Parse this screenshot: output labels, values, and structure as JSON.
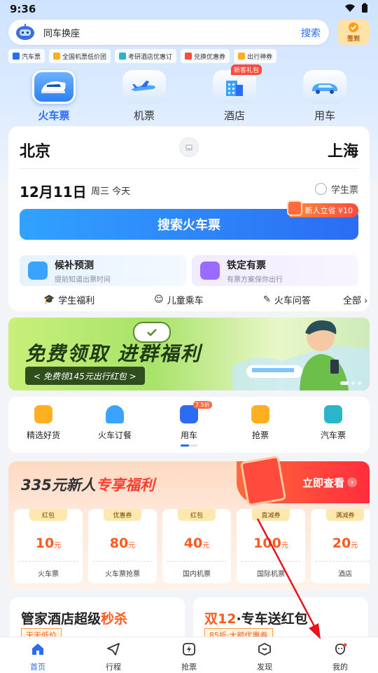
{
  "status_bar": {
    "time": "9:36"
  },
  "search": {
    "placeholder": "同车换座",
    "button": "搜索"
  },
  "signin": {
    "label": "签到"
  },
  "quick_tags": [
    {
      "label": "汽车票",
      "color": "#2b6cf3"
    },
    {
      "label": "全国机票低价团",
      "color": "#ffb020"
    },
    {
      "label": "考研酒店优惠订",
      "color": "#2bb5c8"
    },
    {
      "label": "兑换优惠券",
      "color": "#ff4a3d"
    },
    {
      "label": "出行神券",
      "color": "#ffb020"
    }
  ],
  "categories": [
    {
      "label": "火车票",
      "active": true
    },
    {
      "label": "机票",
      "active": false
    },
    {
      "label": "酒店",
      "active": false,
      "badge": "新客礼包"
    },
    {
      "label": "用车",
      "active": false
    }
  ],
  "booking": {
    "from": "北京",
    "to": "上海",
    "date": "12月11日",
    "weekday": "周三  今天",
    "student_ticket": "学生票",
    "search_button": "搜索火车票",
    "promo": "新人立省 ¥10",
    "features": [
      {
        "title": "候补预测",
        "desc": "提前知道出票时间",
        "color": "#3aa3ff"
      },
      {
        "title": "铁定有票",
        "desc": "有票方案保你出行",
        "color": "#9a6bff"
      }
    ],
    "links": [
      "学生福利",
      "儿童乘车",
      "火车问答",
      "全部 ›"
    ]
  },
  "banner": {
    "headline": "免费领取  进群福利",
    "sub": "< 免费领145元出行红包 >",
    "slides": 3,
    "active_slide": 1
  },
  "services": [
    {
      "label": "精选好货",
      "color": "#ffb020"
    },
    {
      "label": "火车订餐",
      "color": "#3aa3ff"
    },
    {
      "label": "用车",
      "color": "#2b6cf3",
      "badge": "7.5折"
    },
    {
      "label": "抢票",
      "color": "#ffb020"
    },
    {
      "label": "汽车票",
      "color": "#2bb5c8"
    }
  ],
  "newbie": {
    "title_prefix": "335元新人",
    "title_highlight": "专享福利",
    "cta": "立即查看",
    "coupons": [
      {
        "type": "红包",
        "amount": "10",
        "unit": "元",
        "scope": "火车票"
      },
      {
        "type": "优惠券",
        "amount": "80",
        "unit": "元",
        "scope": "火车票抢票"
      },
      {
        "type": "红包",
        "amount": "40",
        "unit": "元",
        "scope": "国内机票"
      },
      {
        "type": "直减券",
        "amount": "100",
        "unit": "元",
        "scope": "国际机票"
      },
      {
        "type": "满减券",
        "amount": "20",
        "unit": "元",
        "scope": "酒店"
      }
    ]
  },
  "bottom_cards": [
    {
      "title": "管家酒店超级",
      "highlight": "秒杀",
      "sub": "天天低价"
    },
    {
      "title_highlight": "双12",
      "title": "·专车送红包",
      "sub": "85折·大额优惠券"
    }
  ],
  "tabbar": [
    {
      "label": "首页",
      "icon": "home-icon",
      "active": true
    },
    {
      "label": "行程",
      "icon": "paper-plane-icon",
      "active": false
    },
    {
      "label": "抢票",
      "icon": "lightning-icon",
      "active": false
    },
    {
      "label": "发现",
      "icon": "discover-icon",
      "active": false
    },
    {
      "label": "我的",
      "icon": "profile-icon",
      "active": false
    }
  ]
}
